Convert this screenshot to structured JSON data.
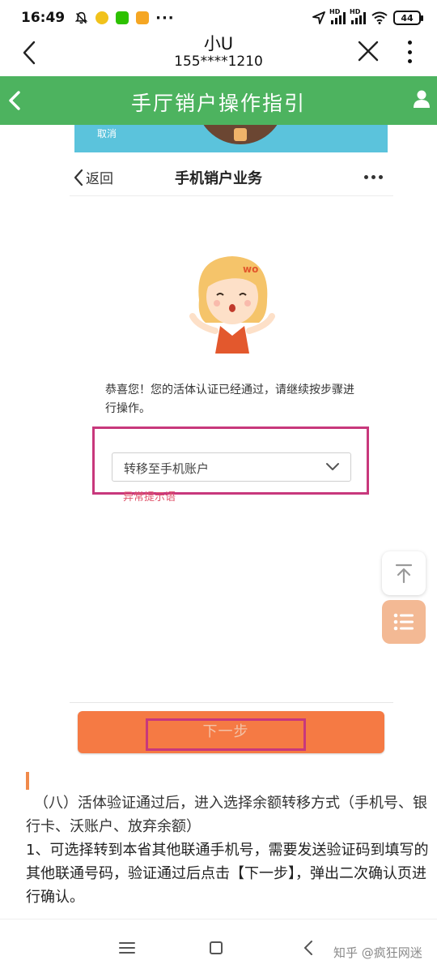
{
  "status_bar": {
    "time": "16:49",
    "dots": "···",
    "signal1_tag": "HD",
    "signal2_tag": "HD",
    "battery": "44"
  },
  "title_bar": {
    "contact_name": "小U",
    "contact_phone": "155****1210"
  },
  "header": {
    "title": "手厅销户操作指引",
    "color": "#4db35f"
  },
  "embedded_screen": {
    "banner_cancel": "取消",
    "nav_back": "返回",
    "nav_title": "手机销户业务",
    "congrats_text": "恭喜您！您的活体认证已经通过，请继续按步骤进行操作。",
    "select_value": "转移至手机账户",
    "error_text": "异常提示语",
    "next_button": "下一步",
    "highlight_color": "#c8387c",
    "button_color": "#f57a44"
  },
  "article": {
    "section_title": "（八）活体验证通过后，进入选择余额转移方式（手机号、银行卡、沃账户、放弃余额）",
    "paragraph": "1、可选择转到本省其他联通手机号，需要发送验证码到填写的其他联通号码，验证通过后点击【下一步】，弹出二次确认页进行确认。"
  },
  "floating": {
    "top_icon": "arrow-up-to-top-icon",
    "list_icon": "list-icon"
  },
  "nav_bar": {
    "watermark": "知乎 @疯狂网迷"
  }
}
